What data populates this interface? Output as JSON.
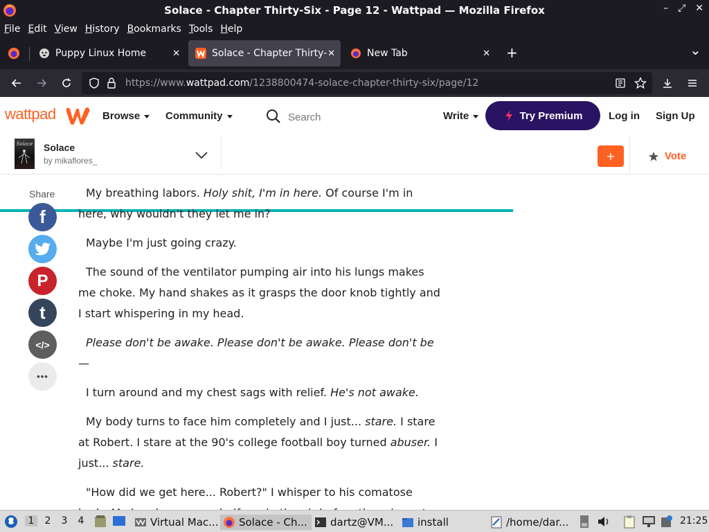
{
  "window": {
    "title": "Solace - Chapter Thirty-Six - Page 12 - Wattpad — Mozilla Firefox",
    "minimize": "–",
    "maximize": "⤢",
    "close": "✕"
  },
  "menubar": {
    "items": [
      "File",
      "Edit",
      "View",
      "History",
      "Bookmarks",
      "Tools",
      "Help"
    ]
  },
  "tabs": [
    {
      "label": "Puppy Linux Home",
      "close": "✕"
    },
    {
      "label": "Solace - Chapter Thirty-Six",
      "close": "✕"
    },
    {
      "label": "New Tab",
      "close": "✕"
    }
  ],
  "new_tab": "+",
  "tab_list": "⌄",
  "navbar": {
    "url_prefix": "https://www.",
    "url_domain": "wattpad.com",
    "url_path": "/1238800474-solace-chapter-thirty-six/page/12"
  },
  "wattpad": {
    "logo_text": "wattpad",
    "browse": "Browse",
    "community": "Community",
    "search_placeholder": "Search",
    "write": "Write",
    "try_premium": "Try Premium",
    "log_in": "Log in",
    "sign_up": "Sign Up"
  },
  "story": {
    "title": "Solace",
    "author": "by mikaflores_",
    "add_label": "+",
    "vote_label": "Vote",
    "progress_fraction": 0.724,
    "cover_title": "Solace"
  },
  "share": {
    "label": "Share",
    "facebook": "f",
    "twitter": "t",
    "pinterest": "P",
    "tumblr": "t",
    "embed": "</>",
    "more": "•••"
  },
  "colors": {
    "wattpad_orange": "#ff6122",
    "premium_purple": "#2a1362",
    "progress": "#00b2b2",
    "facebook": "#3b5998",
    "twitter": "#55acee",
    "pinterest": "#c8232c",
    "tumblr": "#35465c",
    "embed": "#5e5e5e",
    "more": "#ebebeb"
  },
  "paragraphs": [
    [
      {
        "t": "My breathing labors. "
      },
      {
        "t": "Holy shit, I'm in here.",
        "i": true
      },
      {
        "t": " Of course I'm in here, why wouldn't they let me in?"
      }
    ],
    [
      {
        "t": "Maybe I'm just going crazy."
      }
    ],
    [
      {
        "t": "The sound of the ventilator pumping air into his lungs makes me choke. My hand shakes as it grasps the door knob tightly and I start whispering in my head."
      }
    ],
    [
      {
        "t": "Please don't be awake. Please don't be awake. Please don't be—",
        "i": true
      }
    ],
    [
      {
        "t": "I turn around and my chest sags with relief. "
      },
      {
        "t": "He's not awake.",
        "i": true
      }
    ],
    [
      {
        "t": "My body turns to face him completely and I just... "
      },
      {
        "t": "stare.",
        "i": true
      },
      {
        "t": " I stare at Robert. I stare at the 90's college football boy turned "
      },
      {
        "t": "abuser.",
        "i": true
      },
      {
        "t": " I just... "
      },
      {
        "t": "stare.",
        "i": true
      }
    ],
    [
      {
        "t": "\"How did we get here... Robert?\" I whisper to his comatose body. My hands come up halfway in the air before they drop at my sides and I"
      }
    ]
  ],
  "taskbar": {
    "workspaces": [
      "1",
      "2",
      "3",
      "4"
    ],
    "items": [
      {
        "label": "Virtual Mac..."
      },
      {
        "label": "Solace - Ch..."
      },
      {
        "label": "dartz@VM..."
      },
      {
        "label": "install"
      },
      {
        "label": "/home/dar..."
      }
    ],
    "clock": "21:25"
  }
}
